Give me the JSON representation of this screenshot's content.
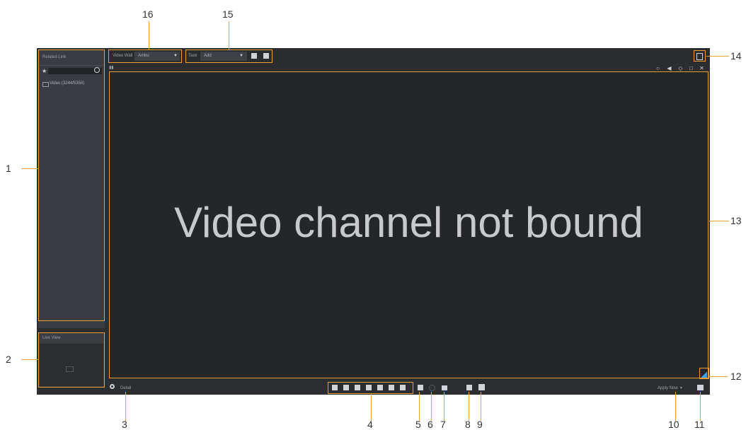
{
  "left_panel": {
    "title": "Related Link",
    "tree_item": "Video (3244/5350)",
    "live_view_title": "Live View"
  },
  "toolbar": {
    "video_wall_label": "Video Wall",
    "video_wall_value": "Ambu",
    "task_label": "Task",
    "task_value": "Add"
  },
  "screen": {
    "message": "Video channel not bound"
  },
  "bottom_bar": {
    "detail_label": "Detail",
    "apply_label": "Apply Now"
  },
  "callouts": [
    "1",
    "2",
    "3",
    "4",
    "5",
    "6",
    "7",
    "8",
    "9",
    "10",
    "11",
    "12",
    "13",
    "14",
    "15",
    "16"
  ],
  "colors": {
    "accent": "#f0a030",
    "panel": "#3a3c41",
    "screen": "#25262a"
  }
}
